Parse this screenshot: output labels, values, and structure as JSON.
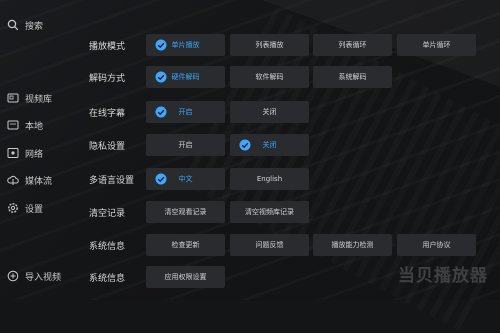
{
  "sidebar": {
    "search": "搜索",
    "items": [
      {
        "label": "视频库",
        "icon": "video-library-icon"
      },
      {
        "label": "本地",
        "icon": "folder-icon"
      },
      {
        "label": "网络",
        "icon": "network-icon"
      },
      {
        "label": "媒体流",
        "icon": "cloud-upload-icon"
      },
      {
        "label": "设置",
        "icon": "gear-icon"
      }
    ],
    "import": "导入视频"
  },
  "settings": {
    "rows": [
      {
        "label": "播放模式",
        "options": [
          "单片播放",
          "列表播放",
          "列表循环",
          "单片循环"
        ],
        "selected": 0
      },
      {
        "label": "解码方式",
        "options": [
          "硬件解码",
          "软件解码",
          "系统解码"
        ],
        "selected": 0
      },
      {
        "label": "在线字幕",
        "options": [
          "开启",
          "关闭"
        ],
        "selected": 0
      },
      {
        "label": "隐私设置",
        "options": [
          "开启",
          "关闭"
        ],
        "selected": 1
      },
      {
        "label": "多语言设置",
        "options": [
          "中文",
          "English"
        ],
        "selected": 0
      },
      {
        "label": "清空记录",
        "options": [
          "清空观看记录",
          "清空视频库记录"
        ],
        "selected": -1
      },
      {
        "label": "系统信息",
        "options": [
          "检查更新",
          "问题反馈",
          "播放能力检测",
          "用户协议"
        ],
        "selected": -1
      },
      {
        "label": "系统信息",
        "options": [
          "应用权限设置"
        ],
        "selected": -1
      }
    ]
  },
  "watermark": "当贝播放器",
  "colors": {
    "accent": "#3ea7ff",
    "button": "#2a2b2f",
    "background": "#141517"
  }
}
